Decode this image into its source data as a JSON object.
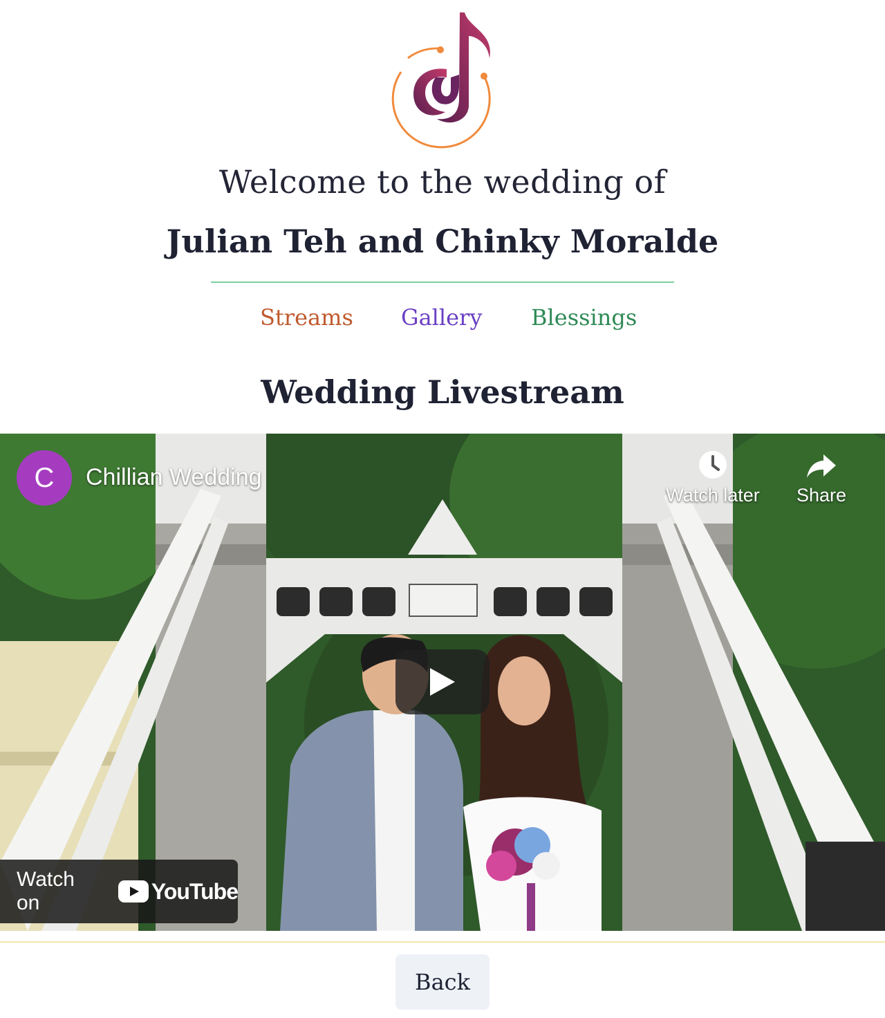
{
  "logo": {
    "name": "music-note-logo-icon",
    "colors": {
      "ring": "#f08a3c",
      "note": "#7a2a6a"
    }
  },
  "header": {
    "welcome": "Welcome to the wedding of",
    "couple": "Julian Teh and Chinky Moralde"
  },
  "nav": {
    "items": [
      {
        "label": "Streams",
        "color": "#c05a2e"
      },
      {
        "label": "Gallery",
        "color": "#6a3fc4"
      },
      {
        "label": "Blessings",
        "color": "#2e8a56"
      }
    ]
  },
  "section": {
    "title": "Wedding Livestream"
  },
  "video": {
    "channel_initial": "C",
    "channel_name": "Chillian Wedding",
    "watch_later_label": "Watch later",
    "share_label": "Share",
    "watch_on_label": "Watch on",
    "youtube_label": "YouTube"
  },
  "footer": {
    "back_label": "Back"
  }
}
